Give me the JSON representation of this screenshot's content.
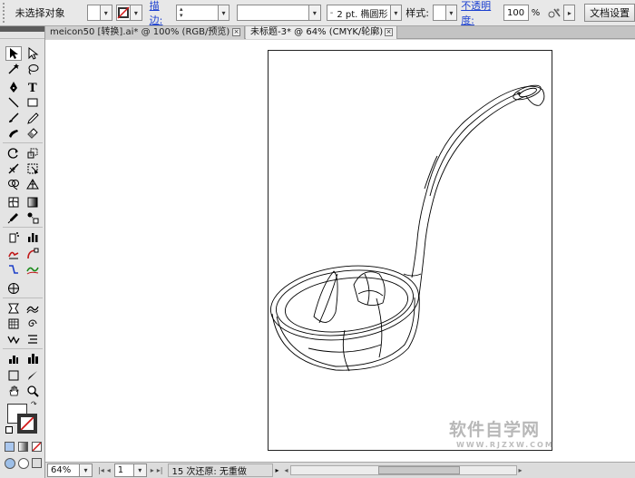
{
  "control_bar": {
    "selection_status": "未选择对象",
    "stroke_link": "描边:",
    "stroke_weight_value": "",
    "variable_width_value": "",
    "brush_definition": "2 pt. 椭圆形",
    "style_label": "样式:",
    "opacity_link": "不透明度:",
    "opacity_value": "100",
    "percent": "%",
    "document_setup_button": "文档设置"
  },
  "document_tabs": [
    {
      "label": "meicon50 [转换].ai* @ 100% (RGB/预览)",
      "active": false,
      "close": "×"
    },
    {
      "label": "未标题-3* @ 64% (CMYK/轮廓)",
      "active": true,
      "close": "×"
    }
  ],
  "tools_panel": {
    "tools": [
      "selection-tool",
      "direct-selection-tool",
      "magic-wand-tool",
      "lasso-tool",
      "pen-tool",
      "type-tool",
      "line-segment-tool",
      "rectangle-tool",
      "paintbrush-tool",
      "pencil-tool",
      "blob-brush-tool",
      "eraser-tool",
      "rotate-tool",
      "scale-tool",
      "width-tool",
      "free-transform-tool",
      "shape-builder-tool",
      "perspective-grid-tool",
      "mesh-tool",
      "gradient-tool",
      "eyedropper-tool",
      "blend-tool",
      "symbol-sprayer-tool",
      "column-graph-tool",
      "artboard-tool",
      "slice-tool",
      "hand-tool",
      "zoom-tool"
    ]
  },
  "status_bar": {
    "zoom": "64%",
    "artboard_number": "1",
    "status_text": "15 次还原: 无重做"
  },
  "watermark": {
    "main": "软件自学网",
    "sub": "WWW.RJZXW.COM"
  },
  "colors": {
    "ui_gray": "#e4e4e4",
    "link_blue": "#1a3fd0",
    "stroke_red": "#d21818"
  }
}
